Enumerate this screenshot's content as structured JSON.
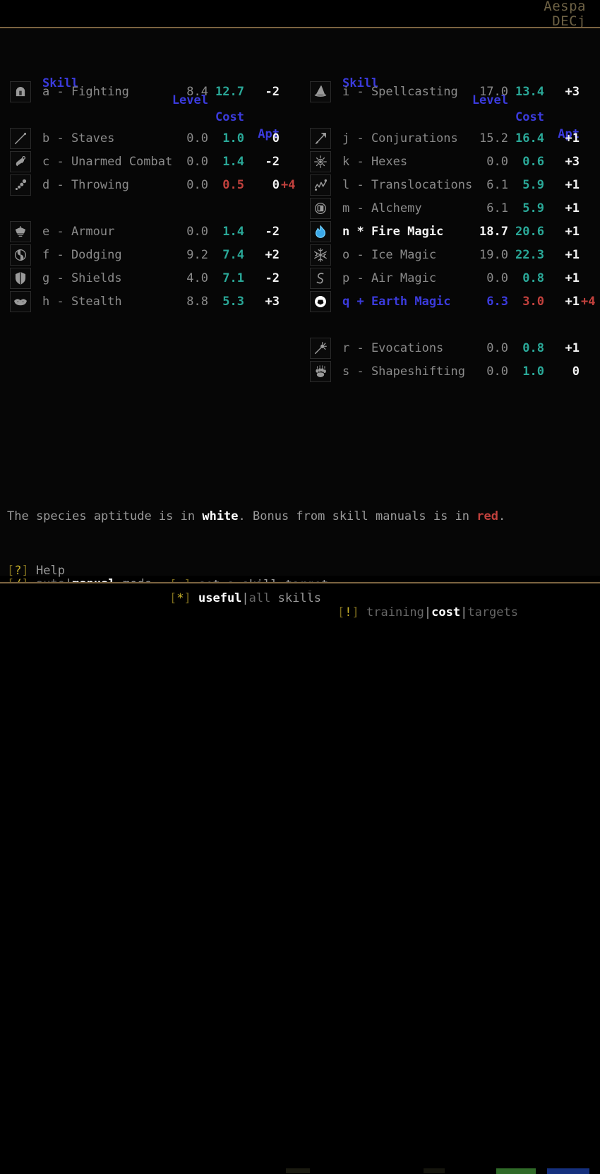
{
  "hud": {
    "player_name": "Aespa",
    "status_line": "DECj"
  },
  "columns": {
    "headers": {
      "skill": "Skill",
      "level": "Level",
      "cost": "Cost",
      "apt": "Apt"
    },
    "left": [
      {
        "icon": "helmet-icon",
        "name": "a - Fighting",
        "level": "8.4",
        "cost": "12.7",
        "apt": "-2",
        "bonus": "",
        "cost_red": false,
        "state": "normal",
        "gap_after": true
      },
      {
        "icon": "staff-icon",
        "name": "b - Staves",
        "level": "0.0",
        "cost": "1.0",
        "apt": "0",
        "bonus": "",
        "cost_red": false,
        "state": "normal",
        "gap_after": false
      },
      {
        "icon": "fist-icon",
        "name": "c - Unarmed Combat",
        "level": "0.0",
        "cost": "1.4",
        "apt": "-2",
        "bonus": "",
        "cost_red": false,
        "state": "normal",
        "gap_after": false
      },
      {
        "icon": "throwing-icon",
        "name": "d - Throwing",
        "level": "0.0",
        "cost": "0.5",
        "apt": "0",
        "bonus": "+4",
        "cost_red": true,
        "state": "normal",
        "gap_after": true
      },
      {
        "icon": "armour-icon",
        "name": "e - Armour",
        "level": "0.0",
        "cost": "1.4",
        "apt": "-2",
        "bonus": "",
        "cost_red": false,
        "state": "normal",
        "gap_after": false
      },
      {
        "icon": "dodging-icon",
        "name": "f - Dodging",
        "level": "9.2",
        "cost": "7.4",
        "apt": "+2",
        "bonus": "",
        "cost_red": false,
        "state": "normal",
        "gap_after": false
      },
      {
        "icon": "shield-icon",
        "name": "g - Shields",
        "level": "4.0",
        "cost": "7.1",
        "apt": "-2",
        "bonus": "",
        "cost_red": false,
        "state": "normal",
        "gap_after": false
      },
      {
        "icon": "stealth-mask-icon",
        "name": "h - Stealth",
        "level": "8.8",
        "cost": "5.3",
        "apt": "+3",
        "bonus": "",
        "cost_red": false,
        "state": "normal",
        "gap_after": false
      }
    ],
    "right": [
      {
        "icon": "wizard-hat-icon",
        "name": "i - Spellcasting",
        "level": "17.0",
        "cost": "13.4",
        "apt": "+3",
        "bonus": "",
        "cost_red": false,
        "state": "normal",
        "gap_after": true
      },
      {
        "icon": "conjurations-icon",
        "name": "j - Conjurations",
        "level": "15.2",
        "cost": "16.4",
        "apt": "+1",
        "bonus": "",
        "cost_red": false,
        "state": "normal",
        "gap_after": false
      },
      {
        "icon": "hexes-icon",
        "name": "k - Hexes",
        "level": "0.0",
        "cost": "0.6",
        "apt": "+3",
        "bonus": "",
        "cost_red": false,
        "state": "normal",
        "gap_after": false
      },
      {
        "icon": "translocations-icon",
        "name": "l - Translocations",
        "level": "6.1",
        "cost": "5.9",
        "apt": "+1",
        "bonus": "",
        "cost_red": false,
        "state": "normal",
        "gap_after": false
      },
      {
        "icon": "alchemy-icon",
        "name": "m - Alchemy",
        "level": "6.1",
        "cost": "5.9",
        "apt": "+1",
        "bonus": "",
        "cost_red": false,
        "state": "normal",
        "gap_after": false
      },
      {
        "icon": "fire-magic-icon",
        "name": "n * Fire Magic",
        "level": "18.7",
        "cost": "20.6",
        "apt": "+1",
        "bonus": "",
        "cost_red": false,
        "state": "selected",
        "gap_after": false
      },
      {
        "icon": "ice-magic-icon",
        "name": "o - Ice Magic",
        "level": "19.0",
        "cost": "22.3",
        "apt": "+1",
        "bonus": "",
        "cost_red": false,
        "state": "normal",
        "gap_after": false
      },
      {
        "icon": "air-magic-icon",
        "name": "p - Air Magic",
        "level": "0.0",
        "cost": "0.8",
        "apt": "+1",
        "bonus": "",
        "cost_red": false,
        "state": "normal",
        "gap_after": false
      },
      {
        "icon": "earth-magic-icon",
        "name": "q + Earth Magic",
        "level": "6.3",
        "cost": "3.0",
        "apt": "+1",
        "bonus": "+4",
        "cost_red": true,
        "state": "target",
        "gap_after": true
      },
      {
        "icon": "evocations-icon",
        "name": "r - Evocations",
        "level": "0.0",
        "cost": "0.8",
        "apt": "+1",
        "bonus": "",
        "cost_red": false,
        "state": "normal",
        "gap_after": false
      },
      {
        "icon": "shapeshifting-icon",
        "name": "s - Shapeshifting",
        "level": "0.0",
        "cost": "1.0",
        "apt": "0",
        "bonus": "",
        "cost_red": false,
        "state": "normal",
        "gap_after": false
      }
    ]
  },
  "legend": {
    "part1": "The species aptitude is in ",
    "white_word": "white",
    "part2": ". Bonus from skill manuals is in ",
    "red_word": "red",
    "part3": "."
  },
  "commands": {
    "help": {
      "key": "?",
      "label": "Help"
    },
    "mode": {
      "key": "/",
      "opt_auto": "auto",
      "opt_manual": "manual",
      "suffix": " mode"
    },
    "target": {
      "key": "=",
      "label": "set a skill target"
    },
    "filter": {
      "key": "*",
      "opt_useful": "useful",
      "opt_all": "all",
      "suffix": " skills"
    },
    "display": {
      "key": "!",
      "opt_training": "training",
      "opt_cost": "cost",
      "opt_targets": "targets"
    }
  },
  "colors": {
    "header_blue": "#3b3bdd",
    "cost_teal": "#2aa898",
    "bonus_red": "#c2413d",
    "apt_white": "#f2f2f2",
    "skill_gray": "#8a8a8a",
    "rule_gold": "#7b6340",
    "hud_olive": "#6e6245",
    "key_yellow": "#c6b02a",
    "status_green": "#2f6a28",
    "status_blue": "#15307e"
  }
}
